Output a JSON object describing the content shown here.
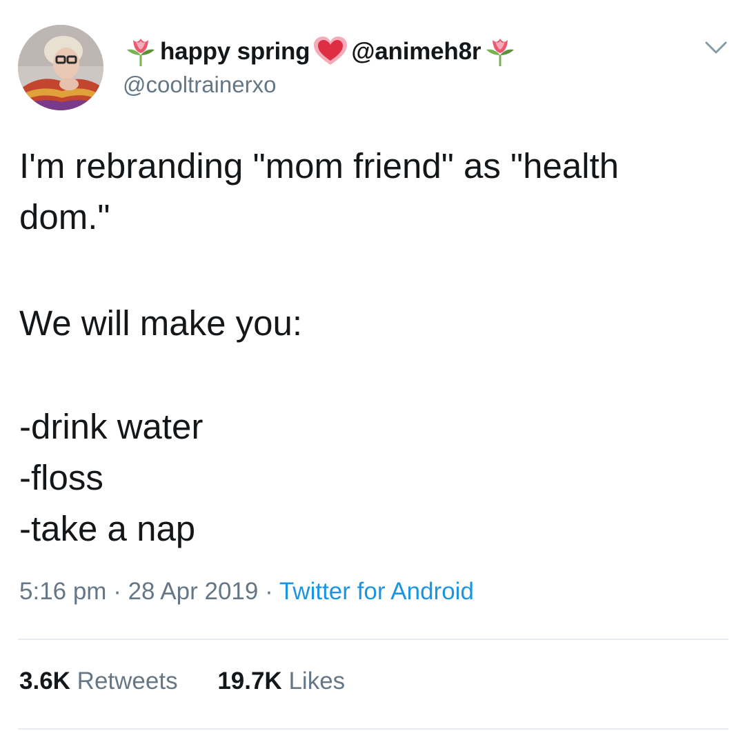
{
  "tweet": {
    "author": {
      "display_name_parts": [
        "happy spring",
        "@animeh8r"
      ],
      "emojis": [
        "tulip-icon",
        "heart-icon",
        "tulip-icon"
      ],
      "handle": "@cooltrainerxo"
    },
    "text": {
      "line1": "I'm rebranding \"mom friend\" as \"health",
      "line2": "dom.\"",
      "line3": "We will make you:",
      "list": [
        "-drink water",
        "-floss",
        "-take a nap"
      ]
    },
    "meta": {
      "time": "5:16 pm",
      "separator": " · ",
      "date": "28 Apr 2019",
      "source": "Twitter for Android"
    },
    "stats": {
      "retweets_count": "3.6K",
      "retweets_label": "Retweets",
      "likes_count": "19.7K",
      "likes_label": "Likes"
    },
    "colors": {
      "text": "#14171a",
      "secondary": "#657786",
      "link": "#1b95e0",
      "divider": "#e6ecf0"
    }
  }
}
